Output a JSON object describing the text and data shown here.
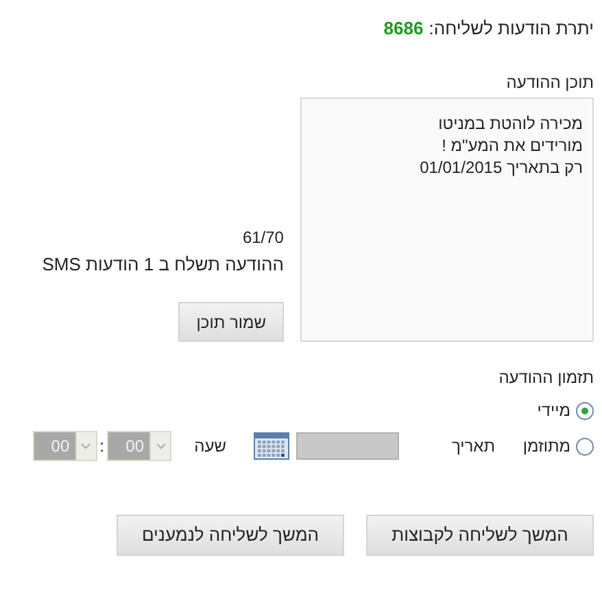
{
  "remaining": {
    "label": "יתרת הודעות לשליחה:",
    "value": "8686"
  },
  "message": {
    "label": "תוכן ההודעה",
    "value": "מכירה לוהטת במניטו\nמורידים את המע\"מ !\nרק בתאריך 01/01/2015",
    "counter": "61/70",
    "info": "ההודעה תשלח ב 1 הודעות SMS",
    "save_button": "שמור תוכן"
  },
  "schedule": {
    "label": "תזמון ההודעה",
    "options": [
      {
        "label": "מיידי",
        "selected": true
      },
      {
        "label": "מתוזמן",
        "selected": false
      }
    ],
    "date_label": "תאריך",
    "time_label": "שעה",
    "hour": "00",
    "separator": ":",
    "minute": "00",
    "disabled": true
  },
  "buttons": [
    "המשך לשליחה לקבוצות",
    "המשך לשליחה לנמענים"
  ]
}
